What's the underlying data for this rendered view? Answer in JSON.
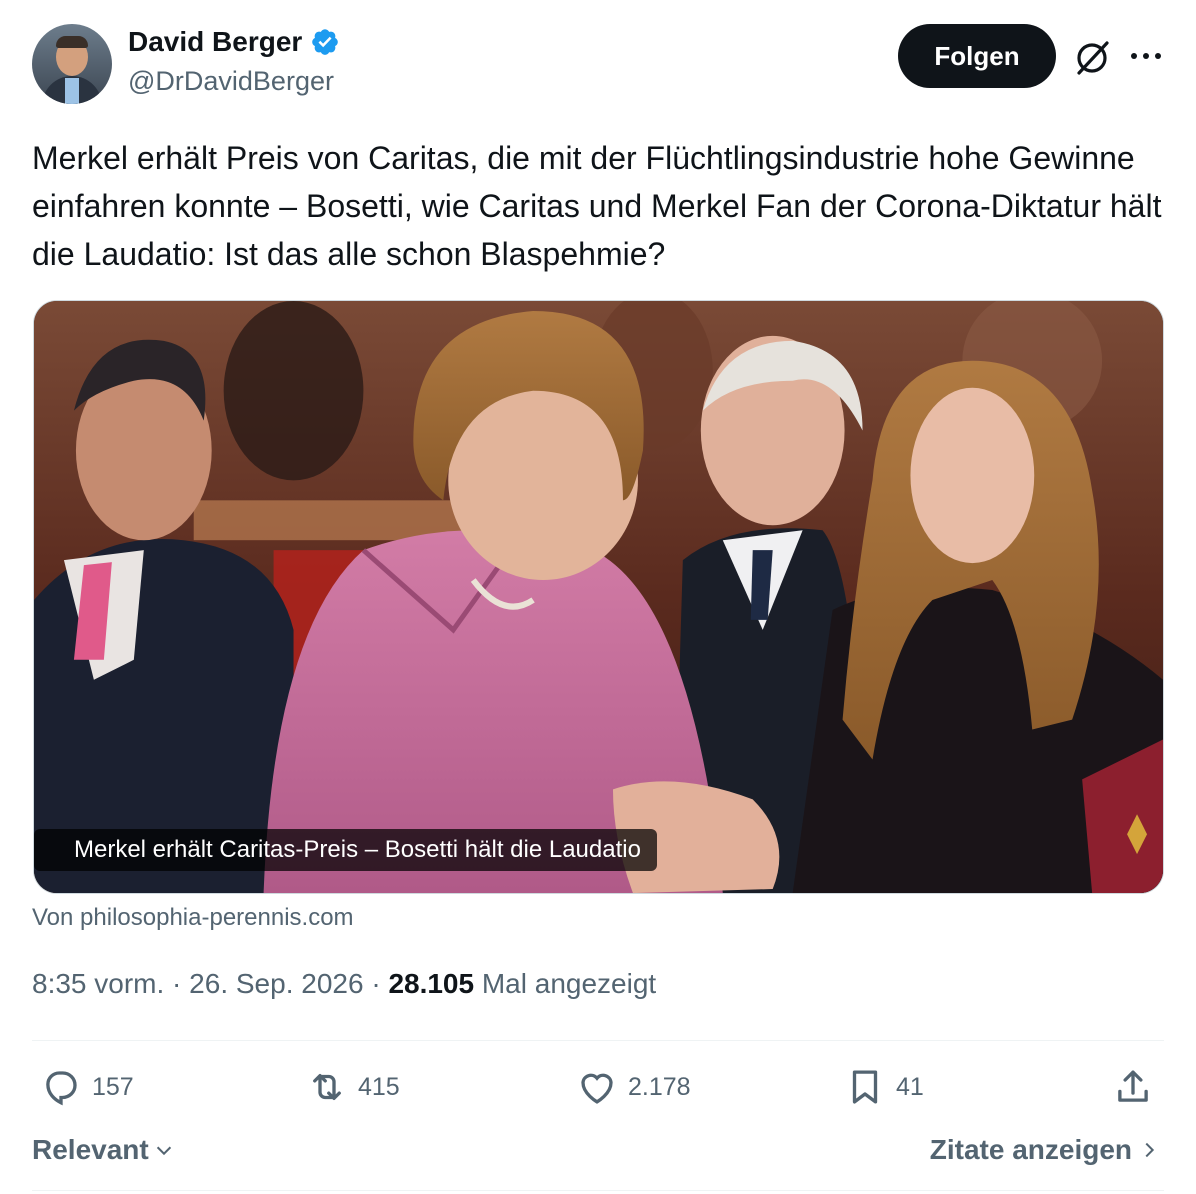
{
  "author": {
    "display_name": "David Berger",
    "handle": "@DrDavidBerger",
    "verified": true
  },
  "header": {
    "follow_label": "Folgen"
  },
  "tweet": {
    "text": "Merkel erhält Preis von Caritas, die mit der Flüchtlingsindustrie hohe Gewinne einfahren konnte – Bosetti, wie Caritas und Merkel Fan der Corona-Diktatur hält die Laudatio: Ist das alle schon Blaspehmie?"
  },
  "media": {
    "caption": "Merkel erhält Caritas-Preis – Bosetti hält die Laudatio",
    "source": "Von philosophia-perennis.com"
  },
  "meta": {
    "time": "8:35 vorm.",
    "separator": " · ",
    "date": "26. Sep. 2026",
    "views": "28.105",
    "views_label": "Mal angezeigt"
  },
  "actions": {
    "replies": "157",
    "reposts": "415",
    "likes": "2.178",
    "bookmarks": "41"
  },
  "footer": {
    "sort_label": "Relevant",
    "quotes_label": "Zitate anzeigen"
  },
  "colors": {
    "verified": "#1d9bf0",
    "text_primary": "#0f1419",
    "text_secondary": "#536471",
    "follow_bg": "#0f1419"
  },
  "icons": [
    "verified-badge-icon",
    "grok-icon",
    "more-icon",
    "reply-icon",
    "repost-icon",
    "like-icon",
    "bookmark-icon",
    "share-icon",
    "chevron-down-icon",
    "chevron-right-icon"
  ]
}
